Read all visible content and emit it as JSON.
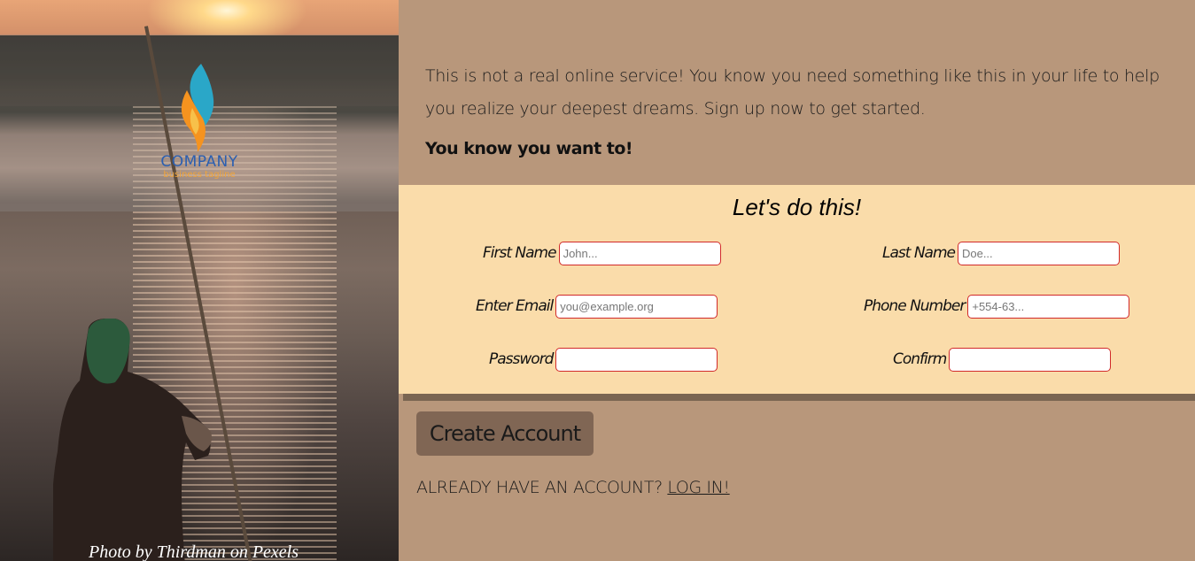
{
  "photo": {
    "credit": "Photo by Thirdman on Pexels"
  },
  "logo": {
    "brand": "COMPANY",
    "tagline": "business tagline",
    "icon": "flame-icon"
  },
  "intro": {
    "text": "This is not a real online service! You know you need something like this in your life to help you realize your deepest dreams. Sign up now to get started.",
    "emphasis": "You know you want to!"
  },
  "form": {
    "title": "Let's do this!",
    "first_name": {
      "label": "First Name",
      "placeholder": "John...",
      "value": ""
    },
    "last_name": {
      "label": "Last Name",
      "placeholder": "Doe...",
      "value": ""
    },
    "email": {
      "label": "Enter Email",
      "placeholder": "you@example.org",
      "value": ""
    },
    "phone": {
      "label": "Phone Number",
      "placeholder": "+554-63...",
      "value": ""
    },
    "password": {
      "label": "Password",
      "placeholder": "",
      "value": ""
    },
    "confirm": {
      "label": "Confirm",
      "placeholder": "",
      "value": ""
    }
  },
  "actions": {
    "create_label": "Create Account",
    "login_prompt": "ALREADY HAVE AN ACCOUNT?",
    "login_link": "LOG IN!"
  },
  "colors": {
    "page_bg": "#b8977b",
    "form_bg": "#fadcaa",
    "button_bg": "#806654",
    "input_border": "#d12a2a"
  }
}
